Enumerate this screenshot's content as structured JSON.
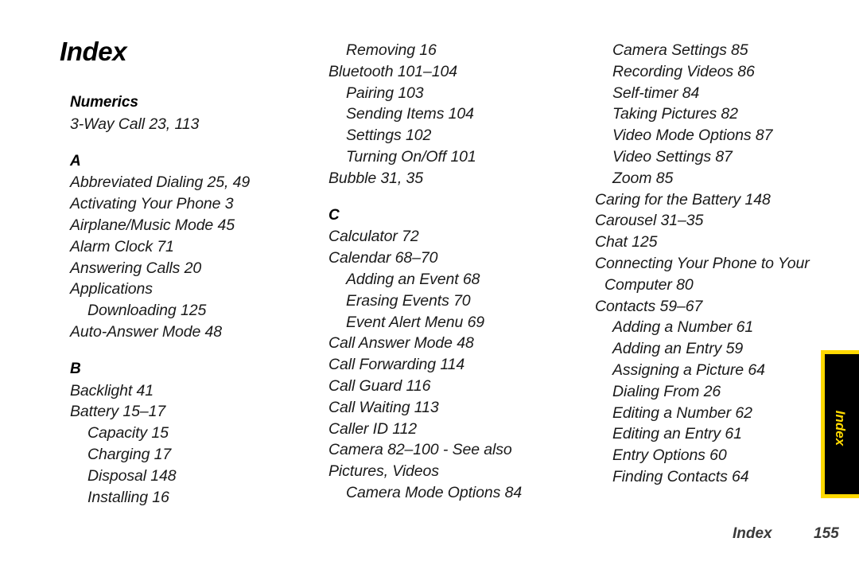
{
  "document": {
    "title": "Index",
    "footer": {
      "label": "Index",
      "page_number": "155"
    },
    "side_tab": {
      "label": "Index",
      "background_color": "#000000",
      "border_color": "#ffd900",
      "text_color": "#ffd900"
    },
    "text_color": "#1a1a1a",
    "background_color": "#ffffff"
  },
  "columns": [
    {
      "id": "column-1",
      "blocks": [
        {
          "type": "section",
          "text": "Numerics"
        },
        {
          "type": "entry",
          "level": 0,
          "text": "3-Way Call  23, 113"
        },
        {
          "type": "section",
          "text": "A"
        },
        {
          "type": "entry",
          "level": 0,
          "text": "Abbreviated Dialing  25, 49"
        },
        {
          "type": "entry",
          "level": 0,
          "text": "Activating Your Phone  3"
        },
        {
          "type": "entry",
          "level": 0,
          "text": "Airplane/Music Mode  45"
        },
        {
          "type": "entry",
          "level": 0,
          "text": "Alarm Clock  71"
        },
        {
          "type": "entry",
          "level": 0,
          "text": "Answering Calls  20"
        },
        {
          "type": "entry",
          "level": 0,
          "text": "Applications"
        },
        {
          "type": "entry",
          "level": 1,
          "text": "Downloading  125"
        },
        {
          "type": "entry",
          "level": 0,
          "text": "Auto-Answer Mode  48"
        },
        {
          "type": "section",
          "text": "B"
        },
        {
          "type": "entry",
          "level": 0,
          "text": "Backlight  41"
        },
        {
          "type": "entry",
          "level": 0,
          "text": "Battery  15–17"
        },
        {
          "type": "entry",
          "level": 1,
          "text": "Capacity  15"
        },
        {
          "type": "entry",
          "level": 1,
          "text": "Charging  17"
        },
        {
          "type": "entry",
          "level": 1,
          "text": "Disposal  148"
        },
        {
          "type": "entry",
          "level": 1,
          "text": "Installing  16"
        }
      ]
    },
    {
      "id": "column-2",
      "blocks": [
        {
          "type": "entry",
          "level": 1,
          "text": "Removing  16"
        },
        {
          "type": "entry",
          "level": 0,
          "text": "Bluetooth  101–104"
        },
        {
          "type": "entry",
          "level": 1,
          "text": "Pairing  103"
        },
        {
          "type": "entry",
          "level": 1,
          "text": "Sending Items  104"
        },
        {
          "type": "entry",
          "level": 1,
          "text": "Settings  102"
        },
        {
          "type": "entry",
          "level": 1,
          "text": "Turning On/Off  101"
        },
        {
          "type": "entry",
          "level": 0,
          "text": "Bubble  31, 35"
        },
        {
          "type": "section",
          "text": "C"
        },
        {
          "type": "entry",
          "level": 0,
          "text": "Calculator  72"
        },
        {
          "type": "entry",
          "level": 0,
          "text": "Calendar  68–70"
        },
        {
          "type": "entry",
          "level": 1,
          "text": "Adding an Event  68"
        },
        {
          "type": "entry",
          "level": 1,
          "text": "Erasing Events  70"
        },
        {
          "type": "entry",
          "level": 1,
          "text": "Event Alert Menu  69"
        },
        {
          "type": "entry",
          "level": 0,
          "text": "Call Answer Mode  48"
        },
        {
          "type": "entry",
          "level": 0,
          "text": "Call Forwarding  114"
        },
        {
          "type": "entry",
          "level": 0,
          "text": "Call Guard  116"
        },
        {
          "type": "entry",
          "level": 0,
          "text": "Call Waiting  113"
        },
        {
          "type": "entry",
          "level": 0,
          "text": "Caller ID  112"
        },
        {
          "type": "entry",
          "level": 0,
          "wrapped": true,
          "text": "Camera  82–100 - See also Pictures, Videos"
        },
        {
          "type": "entry",
          "level": 1,
          "text": "Camera Mode Options  84"
        }
      ]
    },
    {
      "id": "column-3",
      "blocks": [
        {
          "type": "entry",
          "level": 1,
          "text": "Camera Settings  85"
        },
        {
          "type": "entry",
          "level": 1,
          "text": "Recording Videos  86"
        },
        {
          "type": "entry",
          "level": 1,
          "text": "Self-timer  84"
        },
        {
          "type": "entry",
          "level": 1,
          "text": "Taking Pictures  82"
        },
        {
          "type": "entry",
          "level": 1,
          "text": "Video Mode Options  87"
        },
        {
          "type": "entry",
          "level": 1,
          "text": "Video Settings  87"
        },
        {
          "type": "entry",
          "level": 1,
          "text": "Zoom  85"
        },
        {
          "type": "entry",
          "level": 0,
          "text": "Caring for the Battery  148"
        },
        {
          "type": "entry",
          "level": 0,
          "text": "Carousel  31–35"
        },
        {
          "type": "entry",
          "level": 0,
          "text": "Chat  125"
        },
        {
          "type": "entry",
          "level": 0,
          "hanging": true,
          "text": "Connecting Your Phone to Your Computer  80"
        },
        {
          "type": "entry",
          "level": 0,
          "text": "Contacts  59–67"
        },
        {
          "type": "entry",
          "level": 1,
          "text": "Adding a Number  61"
        },
        {
          "type": "entry",
          "level": 1,
          "text": "Adding an Entry 59"
        },
        {
          "type": "entry",
          "level": 1,
          "text": "Assigning a Picture  64"
        },
        {
          "type": "entry",
          "level": 1,
          "text": "Dialing From  26"
        },
        {
          "type": "entry",
          "level": 1,
          "text": "Editing a Number 62"
        },
        {
          "type": "entry",
          "level": 1,
          "text": "Editing an Entry  61"
        },
        {
          "type": "entry",
          "level": 1,
          "text": "Entry Options  60"
        },
        {
          "type": "entry",
          "level": 1,
          "text": "Finding Contacts  64"
        }
      ]
    }
  ]
}
